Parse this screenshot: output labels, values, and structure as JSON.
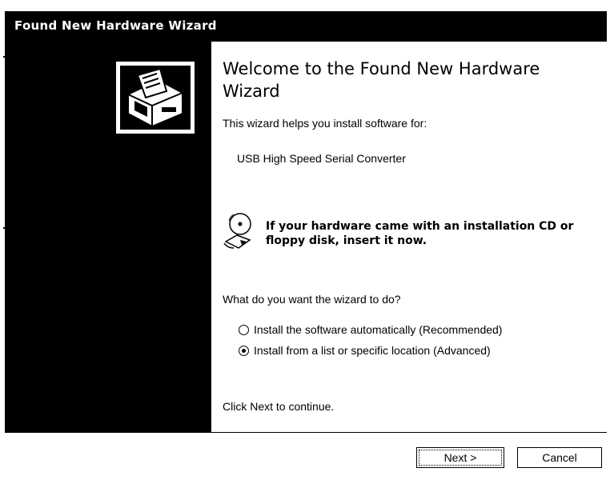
{
  "window": {
    "title": "Found New Hardware Wizard"
  },
  "content": {
    "heading": "Welcome to the Found New Hardware Wizard",
    "intro": "This wizard helps you install software for:",
    "device_name": "USB High Speed Serial Converter",
    "cd_message": "If your hardware came with an installation CD or floppy disk, insert it now.",
    "question": "What do you want the wizard to do?",
    "options": [
      {
        "label": "Install the software automatically (Recommended)",
        "selected": false
      },
      {
        "label": "Install from a list or specific location (Advanced)",
        "selected": true
      }
    ],
    "continue_text": "Click Next to continue."
  },
  "buttons": {
    "next": "Next >",
    "cancel": "Cancel"
  },
  "icons": {
    "wizard": "hardware-wizard-icon",
    "cd": "cd-floppy-icon"
  },
  "colors": {
    "titlebar": "#000000",
    "sidebar": "#000000",
    "content_bg": "#ffffff"
  }
}
